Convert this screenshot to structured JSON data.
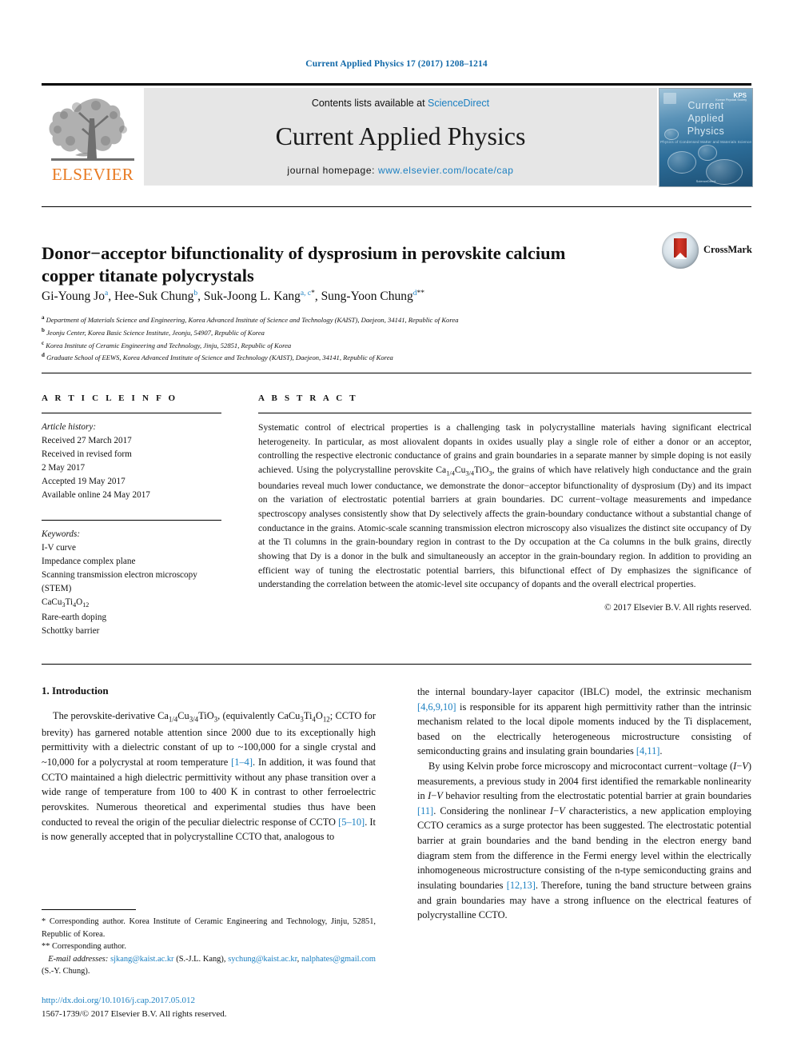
{
  "running_head": "Current Applied Physics 17 (2017) 1208–1214",
  "masthead": {
    "contents_prefix": "Contents lists available at ",
    "sciencedirect": "ScienceDirect",
    "journal_title": "Current Applied Physics",
    "homepage_prefix": "journal homepage: ",
    "homepage_url": "www.elsevier.com/locate/cap",
    "publisher_logo_text": "ELSEVIER",
    "cover": {
      "line1": "Current",
      "line2": "Applied",
      "line3": "Physics",
      "subtitle": "Physics of Condensed Matter and Materials Science",
      "badge": "KPS",
      "badge_sub": "Korean Physical Society",
      "footer": "ScienceDirect"
    }
  },
  "article": {
    "title": "Donor−acceptor bifunctionality of dysprosium in perovskite calcium copper titanate polycrystals",
    "crossmark_label": "CrossMark",
    "authors": [
      {
        "name": "Gi-Young Jo",
        "marks": "a",
        "sep": ", "
      },
      {
        "name": "Hee-Suk Chung",
        "marks": "b",
        "sep": ", "
      },
      {
        "name": "Suk-Joong L. Kang",
        "marks": "a, c",
        "star": "*",
        "sep": ", "
      },
      {
        "name": "Sung-Yoon Chung",
        "marks": "d",
        "star": "**",
        "sep": ""
      }
    ],
    "affiliations": [
      {
        "mark": "a",
        "text": "Department of Materials Science and Engineering, Korea Advanced Institute of Science and Technology (KAIST), Daejeon, 34141, Republic of Korea"
      },
      {
        "mark": "b",
        "text": "Jeonju Center, Korea Basic Science Institute, Jeonju, 54907, Republic of Korea"
      },
      {
        "mark": "c",
        "text": "Korea Institute of Ceramic Engineering and Technology, Jinju, 52851, Republic of Korea"
      },
      {
        "mark": "d",
        "text": "Graduate School of EEWS, Korea Advanced Institute of Science and Technology (KAIST), Daejeon, 34141, Republic of Korea"
      }
    ]
  },
  "article_info": {
    "heading": "A R T I C L E  I N F O",
    "history_label": "Article history:",
    "history": [
      "Received 27 March 2017",
      "Received in revised form",
      "2 May 2017",
      "Accepted 19 May 2017",
      "Available online 24 May 2017"
    ],
    "keywords_label": "Keywords:",
    "keywords": [
      "I-V curve",
      "Impedance complex plane",
      "Scanning transmission electron microscopy",
      "(STEM)",
      "CaCu3Ti4O12",
      "Rare-earth doping",
      "Schottky barrier"
    ]
  },
  "abstract": {
    "heading": "A B S T R A C T",
    "text": "Systematic control of electrical properties is a challenging task in polycrystalline materials having significant electrical heterogeneity. In particular, as most aliovalent dopants in oxides usually play a single role of either a donor or an acceptor, controlling the respective electronic conductance of grains and grain boundaries in a separate manner by simple doping is not easily achieved. Using the polycrystalline perovskite Ca1/4Cu3/4TiO3, the grains of which have relatively high conductance and the grain boundaries reveal much lower conductance, we demonstrate the donor−acceptor bifunctionality of dysprosium (Dy) and its impact on the variation of electrostatic potential barriers at grain boundaries. DC current−voltage measurements and impedance spectroscopy analyses consistently show that Dy selectively affects the grain-boundary conductance without a substantial change of conductance in the grains. Atomic-scale scanning transmission electron microscopy also visualizes the distinct site occupancy of Dy at the Ti columns in the grain-boundary region in contrast to the Dy occupation at the Ca columns in the bulk grains, directly showing that Dy is a donor in the bulk and simultaneously an acceptor in the grain-boundary region. In addition to providing an efficient way of tuning the electrostatic potential barriers, this bifunctional effect of Dy emphasizes the significance of understanding the correlation between the atomic-level site occupancy of dopants and the overall electrical properties.",
    "copyright": "© 2017 Elsevier B.V. All rights reserved."
  },
  "body": {
    "section_heading": "1.  Introduction",
    "left_paragraph_1": "The perovskite-derivative Ca1/4Cu3/4TiO3, (equivalently CaCu3Ti4O12; CCTO for brevity) has garnered notable attention since 2000 due to its exceptionally high permittivity with a dielectric constant of up to ~100,000 for a single crystal and ~10,000 for a polycrystal at room temperature [1–4]. In addition, it was found that CCTO maintained a high dielectric permittivity without any phase transition over a wide range of temperature from 100 to 400 K in contrast to other ferroelectric perovskites. Numerous theoretical and experimental studies thus have been conducted to reveal the origin of the peculiar dielectric response of CCTO [5–10]. It is now generally accepted that in polycrystalline CCTO that, analogous to",
    "right_paragraph_1": "the internal boundary-layer capacitor (IBLC) model, the extrinsic mechanism [4,6,9,10] is responsible for its apparent high permittivity rather than the intrinsic mechanism related to the local dipole moments induced by the Ti displacement, based on the electrically heterogeneous microstructure consisting of semiconducting grains and insulating grain boundaries [4,11].",
    "right_paragraph_2": "By using Kelvin probe force microscopy and microcontact current−voltage (I−V) measurements, a previous study in 2004 first identified the remarkable nonlinearity in I−V behavior resulting from the electrostatic potential barrier at grain boundaries [11]. Considering the nonlinear I−V characteristics, a new application employing CCTO ceramics as a surge protector has been suggested. The electrostatic potential barrier at grain boundaries and the band bending in the electron energy band diagram stem from the difference in the Fermi energy level within the electrically inhomogeneous microstructure consisting of the n-type semiconducting grains and insulating boundaries [12,13]. Therefore, tuning the band structure between grains and grain boundaries may have a strong influence on the electrical features of polycrystalline CCTO."
  },
  "footnotes": {
    "star_note": "* Corresponding author. Korea Institute of Ceramic Engineering and Technology, Jinju, 52851, Republic of Korea.",
    "dstar_note": "** Corresponding author.",
    "email_label": "E-mail addresses:",
    "email_1": "sjkang@kaist.ac.kr",
    "email_1_owner": "(S.-J.L. Kang),",
    "email_2": "sychung@kaist.ac.kr",
    "email_3": "nalphates@gmail.com",
    "email_3_owner": "(S.-Y. Chung).",
    "doi": "http://dx.doi.org/10.1016/j.cap.2017.05.012",
    "issn_line": "1567-1739/© 2017 Elsevier B.V. All rights reserved."
  },
  "colors": {
    "link": "#1a7fc1",
    "elsevier_orange": "#e87a22",
    "crossmark_red": "#d8392a"
  }
}
